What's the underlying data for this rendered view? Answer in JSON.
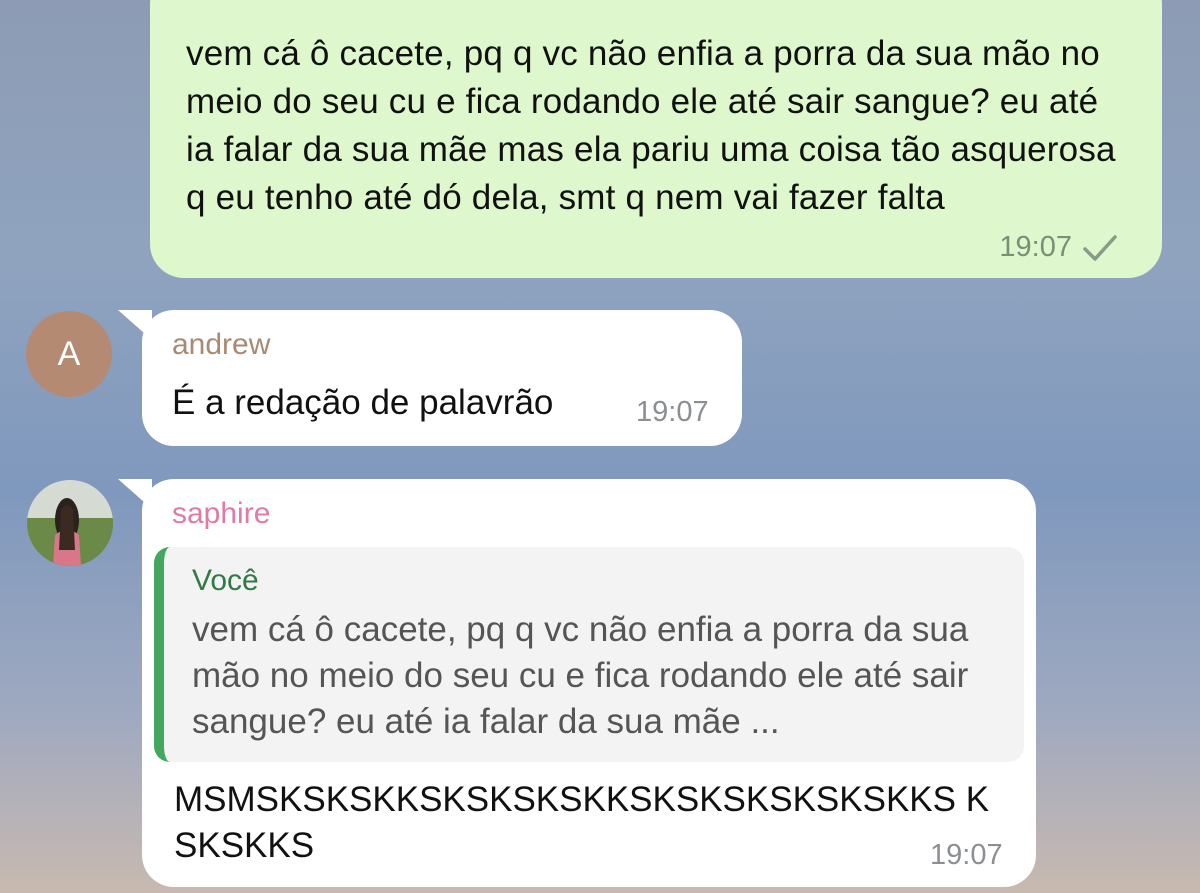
{
  "messages": {
    "outgoing": {
      "text": "vem cá ô cacete, pq q vc não enfia a porra da sua mão no meio do seu cu e fica rodando ele até sair sangue? eu até ia falar da sua mãe mas ela pariu uma coisa tão asquerosa q eu tenho até dó dela, smt q nem vai fazer falta",
      "time": "19:07",
      "status_icon": "single-check-icon"
    },
    "andrew": {
      "avatar_letter": "A",
      "avatar_color": "#b48a73",
      "sender": "andrew",
      "sender_color": "#a88a72",
      "text": "É a redação de palavrão",
      "time": "19:07"
    },
    "saphire": {
      "sender": "saphire",
      "sender_color": "#e07aa6",
      "reply_to": {
        "name": "Você",
        "text": "vem cá ô cacete, pq q vc não enfia a porra da sua mão no meio do seu cu e fica rodando ele até sair sangue? eu até ia falar da sua mãe ..."
      },
      "text": "MSMSKSKSKKSKSKSKSKKSKSKSKSKSKSKKS KSKSKKS",
      "time": "19:07"
    }
  },
  "colors": {
    "outgoing_bubble": "#def7cc",
    "incoming_bubble": "#ffffff",
    "reply_accent": "#44a760"
  }
}
